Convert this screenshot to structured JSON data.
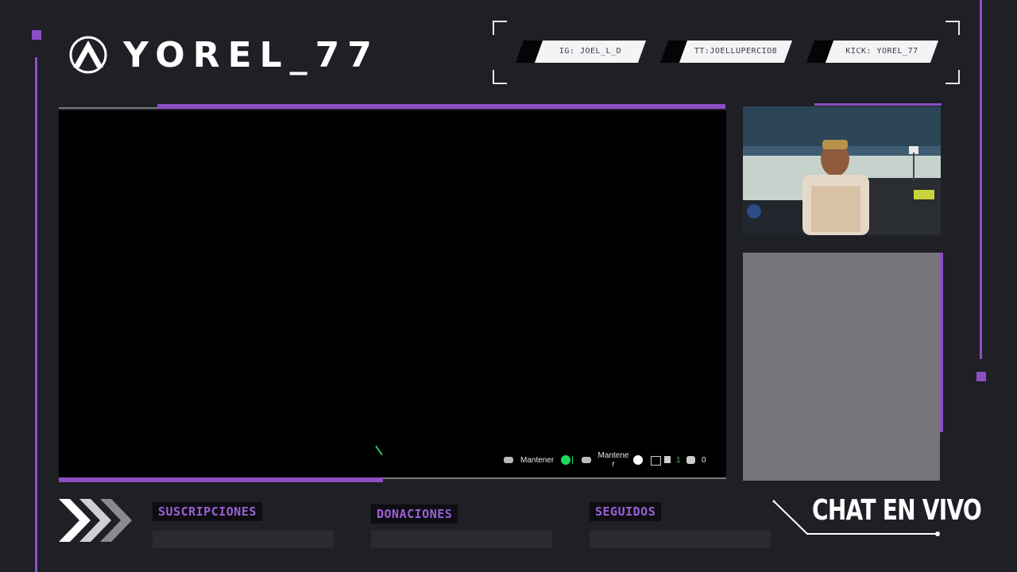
{
  "channel": {
    "name": "YOREL_77"
  },
  "socials": [
    {
      "label": "IG: JOEL_L_D"
    },
    {
      "label": "TT:JOELLUPERCIO8"
    },
    {
      "label": "KICK: YOREL_77"
    }
  ],
  "stats": {
    "subscriptions_label": "SUSCRIPCIONES",
    "donations_label": "DONACIONES",
    "followers_label": "SEGUIDOS"
  },
  "chat": {
    "title": "CHAT EN VIVO"
  },
  "hud": {
    "hold_left": "Mantener",
    "hold_right": "Mantene r",
    "count_a": "1",
    "count_b": "0"
  },
  "colors": {
    "accent": "#8b4fc4",
    "background": "#1f1f26"
  }
}
